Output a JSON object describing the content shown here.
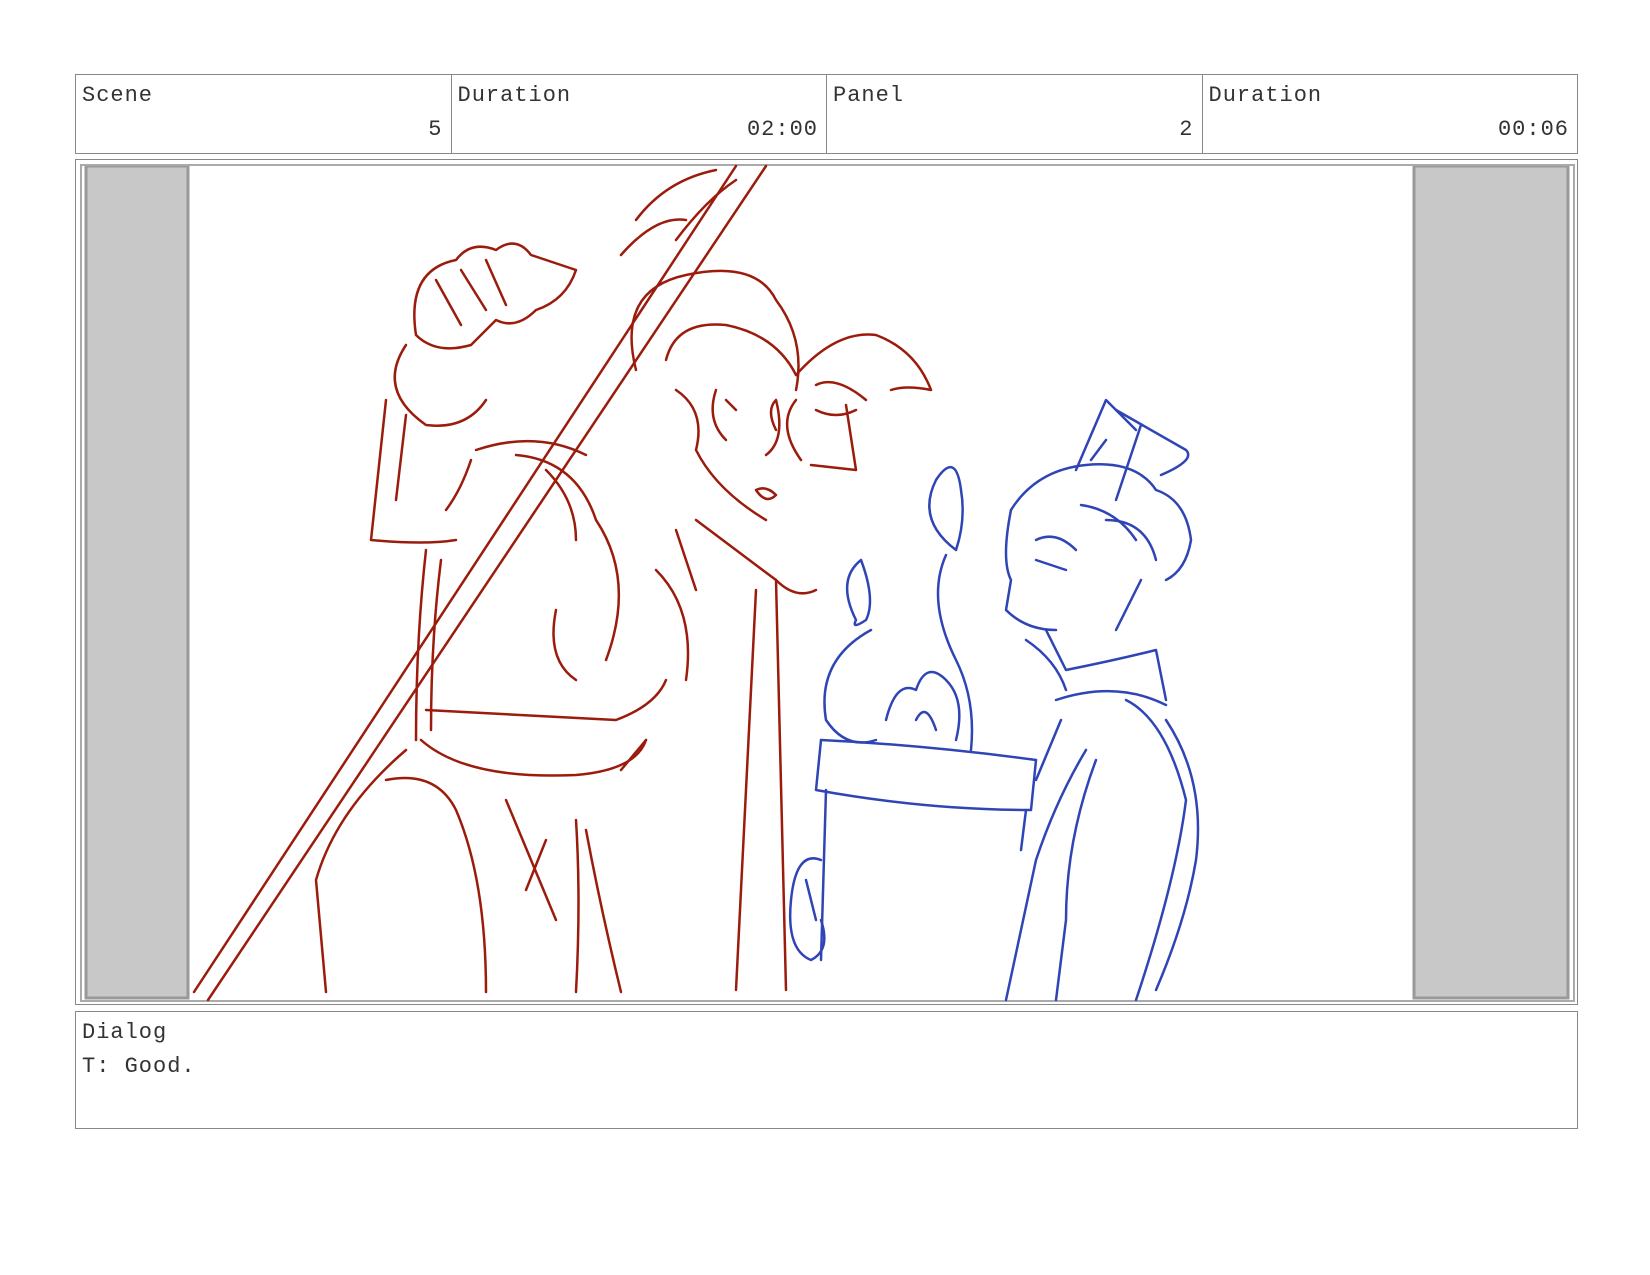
{
  "header": {
    "scene_label": "Scene",
    "scene_value": "5",
    "scene_duration_label": "Duration",
    "scene_duration_value": "02:00",
    "panel_label": "Panel",
    "panel_value": "2",
    "panel_duration_label": "Duration",
    "panel_duration_value": "00:06"
  },
  "drawing": {
    "subject": "storyboard-sketch",
    "left_character_color": "#9b1c0c",
    "right_character_color": "#2f45b5",
    "letterbox_color": "#c8c8c8"
  },
  "dialog": {
    "label": "Dialog",
    "text": "T: Good."
  }
}
